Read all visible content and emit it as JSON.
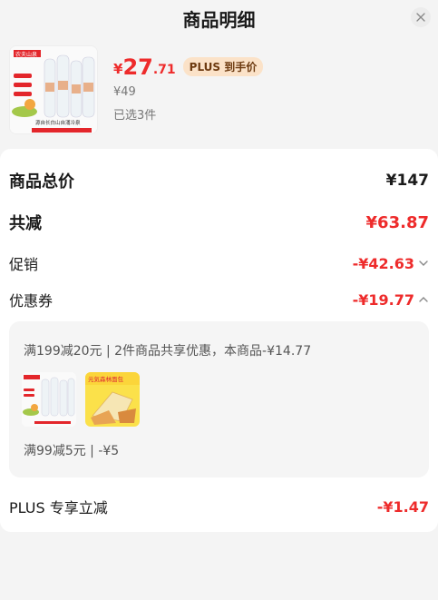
{
  "header": {
    "title": "商品明细",
    "close_icon": "close-icon"
  },
  "product": {
    "price_currency": "¥",
    "price_integer": "27",
    "price_decimal": ".71",
    "plus_badge": "PLUS 到手价",
    "original_price": "¥49",
    "selected_count": "已选3件",
    "thumb_brand": "农夫山泉",
    "thumb_caption": "源自长白山自涌冷泉"
  },
  "summary": {
    "total_label": "商品总价",
    "total_value": "¥147",
    "discount_label": "共减",
    "discount_value": "¥63.87",
    "promo_label": "促销",
    "promo_value": "-¥42.63",
    "coupon_label": "优惠券",
    "coupon_value": "-¥19.77",
    "plus_label": "PLUS 专享立减",
    "plus_value": "-¥1.47"
  },
  "coupon_detail": {
    "line1": "满199减20元 | 2件商品共享优惠，本商品-¥14.77",
    "line2": "满99减5元 | -¥5",
    "thumb2_caption": "元気森林面包"
  },
  "colors": {
    "accent_red": "#ee2b2b",
    "plus_badge_bg": "#fbe2c8"
  }
}
